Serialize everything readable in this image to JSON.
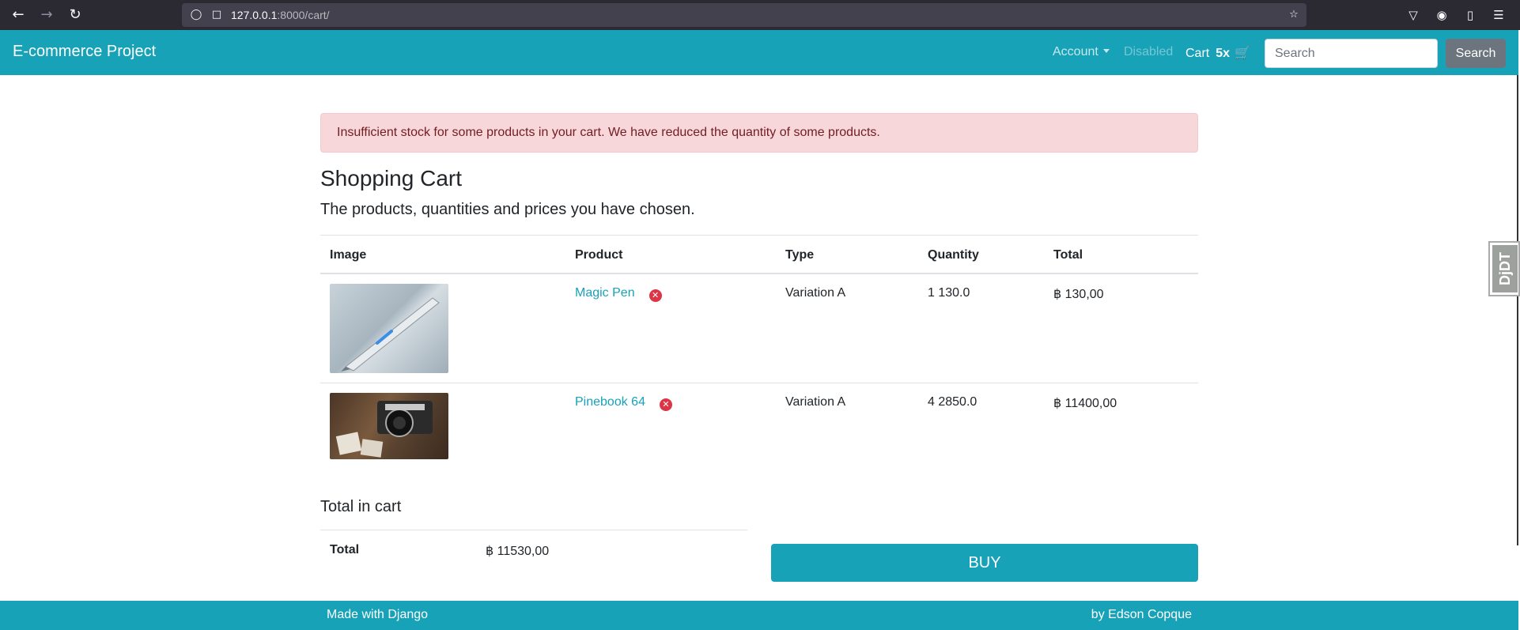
{
  "browser": {
    "url_host": "127.0.0.1",
    "url_rest": ":8000/cart/"
  },
  "navbar": {
    "brand": "E-commerce Project",
    "account": "Account",
    "disabled": "Disabled",
    "cart_label": "Cart",
    "cart_count": "5x",
    "search_placeholder": "Search",
    "search_button": "Search"
  },
  "alert": "Insufficient stock for some products in your cart. We have reduced the quantity of some products.",
  "page": {
    "title": "Shopping Cart",
    "lead": "The products, quantities and prices you have chosen."
  },
  "table": {
    "headers": [
      "Image",
      "Product",
      "Type",
      "Quantity",
      "Total"
    ],
    "rows": [
      {
        "product": "Magic Pen",
        "type": "Variation A",
        "quantity": "1 130.0",
        "total": "฿ 130,00",
        "image": "pen-photo"
      },
      {
        "product": "Pinebook 64",
        "type": "Variation A",
        "quantity": "4 2850.0",
        "total": "฿ 11400,00",
        "image": "camera-photo"
      }
    ]
  },
  "summary": {
    "title": "Total in cart",
    "label": "Total",
    "value": "฿ 11530,00",
    "buy": "BUY"
  },
  "footer": {
    "left": "Made with Django",
    "right": "by Edson Copque"
  },
  "debug_toolbar": "DjDT",
  "colors": {
    "primary": "#17a2b8",
    "danger": "#dc3545",
    "alert_bg": "#f8d7da"
  }
}
